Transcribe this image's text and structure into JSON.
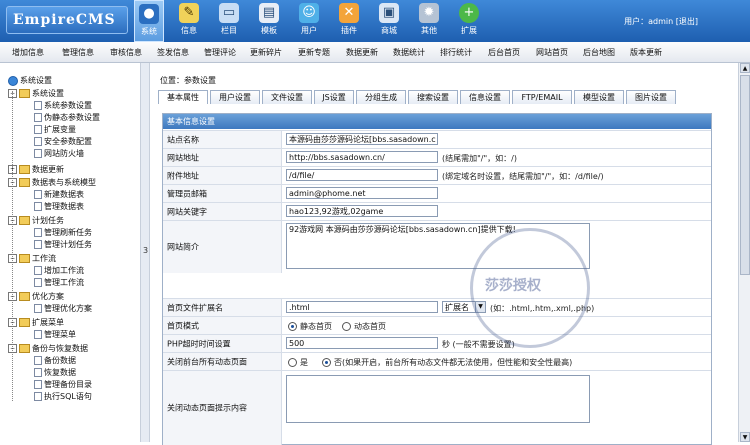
{
  "header": {
    "logo": "EmpireCMS",
    "user_text": "用户：admin [退出]",
    "nav": [
      {
        "label": "系统",
        "icon": "globe-icon",
        "glyph": "●"
      },
      {
        "label": "信息",
        "icon": "edit-icon",
        "glyph": "✎"
      },
      {
        "label": "栏目",
        "icon": "folder-icon",
        "glyph": "▭"
      },
      {
        "label": "模板",
        "icon": "template-icon",
        "glyph": "▤"
      },
      {
        "label": "用户",
        "icon": "user-icon",
        "glyph": "☺"
      },
      {
        "label": "插件",
        "icon": "tools-icon",
        "glyph": "✕"
      },
      {
        "label": "商城",
        "icon": "shop-icon",
        "glyph": "▣"
      },
      {
        "label": "其他",
        "icon": "gear-icon",
        "glyph": "✹"
      },
      {
        "label": "扩展",
        "icon": "plus-icon",
        "glyph": "+"
      }
    ]
  },
  "subnav": [
    "增加信息",
    "管理信息",
    "审核信息",
    "签发信息",
    "管理评论",
    "更新碎片",
    "更新专题",
    "数据更新",
    "数据统计",
    "排行统计",
    "后台首页",
    "网站首页",
    "后台地图",
    "版本更新"
  ],
  "sidebar": {
    "root": "系统设置",
    "items": [
      {
        "label": "系统设置",
        "type": "folder"
      },
      {
        "label": "系统参数设置",
        "type": "doc"
      },
      {
        "label": "伪静态参数设置",
        "type": "doc"
      },
      {
        "label": "扩展变量",
        "type": "doc"
      },
      {
        "label": "安全参数配置",
        "type": "doc"
      },
      {
        "label": "网站防火墙",
        "type": "doc"
      },
      {
        "label": "数据更新",
        "type": "folder"
      },
      {
        "label": "数据表与系统模型",
        "type": "folder"
      },
      {
        "label": "新建数据表",
        "type": "doc"
      },
      {
        "label": "管理数据表",
        "type": "doc"
      },
      {
        "label": "计划任务",
        "type": "folder"
      },
      {
        "label": "管理刷新任务",
        "type": "doc"
      },
      {
        "label": "管理计划任务",
        "type": "doc"
      },
      {
        "label": "工作流",
        "type": "folder"
      },
      {
        "label": "增加工作流",
        "type": "doc"
      },
      {
        "label": "管理工作流",
        "type": "doc"
      },
      {
        "label": "优化方案",
        "type": "folder"
      },
      {
        "label": "管理优化方案",
        "type": "doc"
      },
      {
        "label": "扩展菜单",
        "type": "folder"
      },
      {
        "label": "管理菜单",
        "type": "doc"
      },
      {
        "label": "备份与恢复数据",
        "type": "folder"
      },
      {
        "label": "备份数据",
        "type": "doc"
      },
      {
        "label": "恢复数据",
        "type": "doc"
      },
      {
        "label": "管理备份目录",
        "type": "doc"
      },
      {
        "label": "执行SQL语句",
        "type": "doc"
      }
    ]
  },
  "splitter_glyph": "3",
  "content": {
    "location": "位置：参数设置",
    "tabs": [
      "基本属性",
      "用户设置",
      "文件设置",
      "JS设置",
      "分组生成",
      "搜索设置",
      "信息设置",
      "FTP/EMAIL",
      "模型设置",
      "图片设置"
    ],
    "form_title": "基本信息设置",
    "fields": {
      "site_name": {
        "label": "站点名称",
        "value": "本源码由莎莎源码论坛[bbs.sasadown.c"
      },
      "site_url": {
        "label": "网站地址",
        "value": "http://bbs.sasadown.cn/",
        "hint": "(结尾需加\"/\"，如：/)"
      },
      "attach_url": {
        "label": "附件地址",
        "value": "/d/file/",
        "hint": "(绑定域名时设置，结尾需加\"/\"，如：/d/file/)"
      },
      "admin_email": {
        "label": "管理员邮箱",
        "value": "admin@phome.net"
      },
      "keywords": {
        "label": "网站关键字",
        "value": "hao123,92游戏,02game"
      },
      "intro": {
        "label": "网站简介",
        "value": "92游戏网 本源码由莎莎源码论坛[bbs.sasadown.cn]提供下载!"
      },
      "index_ext": {
        "label": "首页文件扩展名",
        "value": ".html",
        "select": "扩展名",
        "hint": "(如：.html,.htm,.xml,.php)"
      },
      "index_mode": {
        "label": "首页模式",
        "opt1": "静态首页",
        "opt2": "动态首页"
      },
      "php_timeout": {
        "label": "PHP超时时间设置",
        "value": "500",
        "hint": "秒 (一般不需要设置)"
      },
      "close_dynamic": {
        "label": "关闭前台所有动态页面",
        "opt1": "是",
        "opt2": "否(如果开启，前台所有动态文件都无法使用，但性能和安全性最高)"
      },
      "close_tip": {
        "label": "关闭动态页面提示内容",
        "value": ""
      }
    },
    "watermark": "莎莎授权"
  }
}
